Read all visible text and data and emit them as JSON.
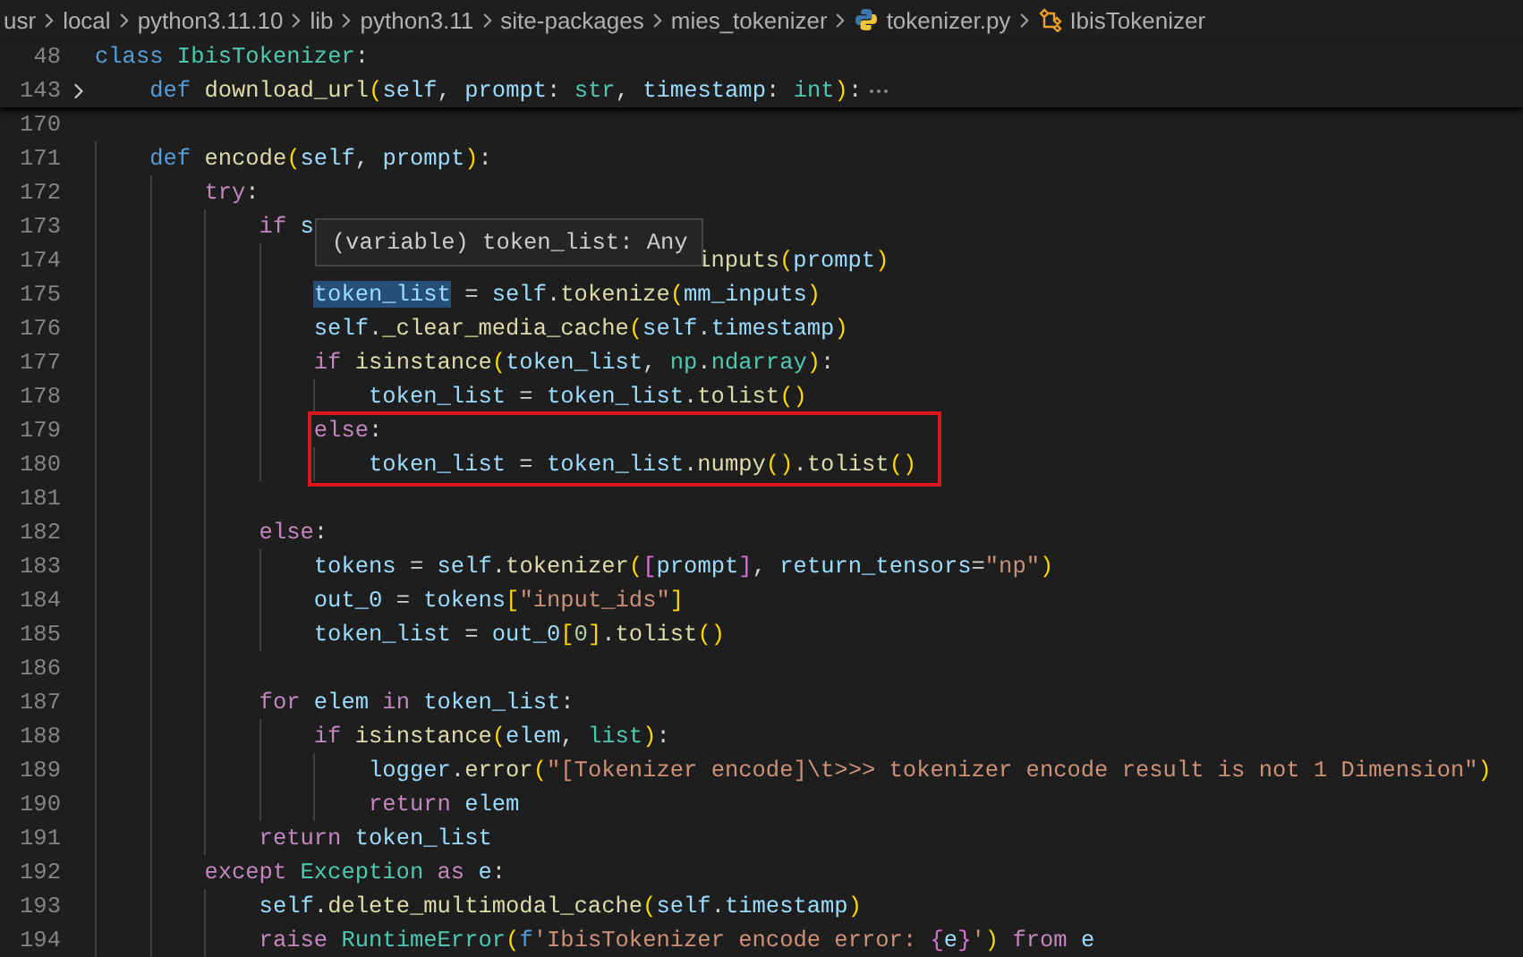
{
  "breadcrumbs": [
    {
      "label": "usr",
      "kind": "folder"
    },
    {
      "label": "local",
      "kind": "folder"
    },
    {
      "label": "python3.11.10",
      "kind": "folder"
    },
    {
      "label": "lib",
      "kind": "folder"
    },
    {
      "label": "python3.11",
      "kind": "folder"
    },
    {
      "label": "site-packages",
      "kind": "folder"
    },
    {
      "label": "mies_tokenizer",
      "kind": "folder"
    },
    {
      "label": "tokenizer.py",
      "kind": "file"
    },
    {
      "label": "IbisTokenizer",
      "kind": "class"
    }
  ],
  "sticky_lines": [
    {
      "number": "48",
      "folded": false,
      "tokens": [
        {
          "text": "class ",
          "kind": "storage"
        },
        {
          "text": "IbisTokenizer",
          "kind": "type"
        },
        {
          "text": ":",
          "kind": "punc"
        }
      ]
    },
    {
      "number": "143",
      "folded": true,
      "tokens": [
        {
          "text": "    def ",
          "kind": "storage"
        },
        {
          "text": "download_url",
          "kind": "fn"
        },
        {
          "text": "(",
          "kind": "b1"
        },
        {
          "text": "self",
          "kind": "var"
        },
        {
          "text": ", ",
          "kind": "punc"
        },
        {
          "text": "prompt",
          "kind": "var"
        },
        {
          "text": ": ",
          "kind": "punc"
        },
        {
          "text": "str",
          "kind": "type"
        },
        {
          "text": ", ",
          "kind": "punc"
        },
        {
          "text": "timestamp",
          "kind": "var"
        },
        {
          "text": ": ",
          "kind": "punc"
        },
        {
          "text": "int",
          "kind": "type"
        },
        {
          "text": ")",
          "kind": "b1"
        },
        {
          "text": ":",
          "kind": "punc"
        }
      ]
    }
  ],
  "lines": [
    {
      "number": "170",
      "boxed": false
    },
    {
      "number": "171",
      "boxed": false,
      "tokens": [
        {
          "text": "    def ",
          "kind": "storage"
        },
        {
          "text": "encode",
          "kind": "fn"
        },
        {
          "text": "(",
          "kind": "b1"
        },
        {
          "text": "self",
          "kind": "var"
        },
        {
          "text": ", ",
          "kind": "punc"
        },
        {
          "text": "prompt",
          "kind": "var"
        },
        {
          "text": ")",
          "kind": "b1"
        },
        {
          "text": ":",
          "kind": "punc"
        }
      ]
    },
    {
      "number": "172",
      "boxed": false,
      "tokens": [
        {
          "text": "        try",
          "kind": "control"
        },
        {
          "text": ":",
          "kind": "punc"
        }
      ]
    },
    {
      "number": "173",
      "boxed": false,
      "hover": "(variable) token_list: Any",
      "tokens": [
        {
          "text": "            if ",
          "kind": "control"
        },
        {
          "text": "s",
          "kind": "var"
        }
      ]
    },
    {
      "number": "174",
      "boxed": false,
      "tokens": [
        {
          "text": "                                            inputs",
          "kind": "fn"
        },
        {
          "text": "(",
          "kind": "b1"
        },
        {
          "text": "prompt",
          "kind": "var"
        },
        {
          "text": ")",
          "kind": "b1"
        }
      ]
    },
    {
      "number": "175",
      "boxed": false,
      "tokens": [
        {
          "text": "                token_list",
          "kind": "var",
          "highlighted": true
        },
        {
          "text": " = ",
          "kind": "punc"
        },
        {
          "text": "self",
          "kind": "var"
        },
        {
          "text": ".",
          "kind": "punc"
        },
        {
          "text": "tokenize",
          "kind": "fn"
        },
        {
          "text": "(",
          "kind": "b1"
        },
        {
          "text": "mm_inputs",
          "kind": "var"
        },
        {
          "text": ")",
          "kind": "b1"
        }
      ]
    },
    {
      "number": "176",
      "boxed": false,
      "tokens": [
        {
          "text": "                self",
          "kind": "var"
        },
        {
          "text": ".",
          "kind": "punc"
        },
        {
          "text": "_clear_media_cache",
          "kind": "fn"
        },
        {
          "text": "(",
          "kind": "b1"
        },
        {
          "text": "self",
          "kind": "var"
        },
        {
          "text": ".",
          "kind": "punc"
        },
        {
          "text": "timestamp",
          "kind": "var"
        },
        {
          "text": ")",
          "kind": "b1"
        }
      ]
    },
    {
      "number": "177",
      "boxed": false,
      "tokens": [
        {
          "text": "                if ",
          "kind": "control"
        },
        {
          "text": "isinstance",
          "kind": "fn"
        },
        {
          "text": "(",
          "kind": "b1"
        },
        {
          "text": "token_list",
          "kind": "var"
        },
        {
          "text": ", ",
          "kind": "punc"
        },
        {
          "text": "np",
          "kind": "type"
        },
        {
          "text": ".",
          "kind": "punc"
        },
        {
          "text": "ndarray",
          "kind": "type"
        },
        {
          "text": ")",
          "kind": "b1"
        },
        {
          "text": ":",
          "kind": "punc"
        }
      ]
    },
    {
      "number": "178",
      "boxed": false,
      "tokens": [
        {
          "text": "                    token_list",
          "kind": "var"
        },
        {
          "text": " = ",
          "kind": "punc"
        },
        {
          "text": "token_list",
          "kind": "var"
        },
        {
          "text": ".",
          "kind": "punc"
        },
        {
          "text": "tolist",
          "kind": "fn"
        },
        {
          "text": "()",
          "kind": "b1"
        }
      ]
    },
    {
      "number": "179",
      "boxed": true,
      "tokens": [
        {
          "text": "                else",
          "kind": "control"
        },
        {
          "text": ":",
          "kind": "punc"
        }
      ]
    },
    {
      "number": "180",
      "boxed": true,
      "tokens": [
        {
          "text": "                    token_list",
          "kind": "var"
        },
        {
          "text": " = ",
          "kind": "punc"
        },
        {
          "text": "token_list",
          "kind": "var"
        },
        {
          "text": ".",
          "kind": "punc"
        },
        {
          "text": "numpy",
          "kind": "fn"
        },
        {
          "text": "()",
          "kind": "b1"
        },
        {
          "text": ".",
          "kind": "punc"
        },
        {
          "text": "tolist",
          "kind": "fn"
        },
        {
          "text": "()",
          "kind": "b1"
        }
      ]
    },
    {
      "number": "181",
      "boxed": false
    },
    {
      "number": "182",
      "boxed": false,
      "tokens": [
        {
          "text": "            else",
          "kind": "control"
        },
        {
          "text": ":",
          "kind": "punc"
        }
      ]
    },
    {
      "number": "183",
      "boxed": false,
      "tokens": [
        {
          "text": "                tokens",
          "kind": "var"
        },
        {
          "text": " = ",
          "kind": "punc"
        },
        {
          "text": "self",
          "kind": "var"
        },
        {
          "text": ".",
          "kind": "punc"
        },
        {
          "text": "tokenizer",
          "kind": "fn"
        },
        {
          "text": "(",
          "kind": "b1"
        },
        {
          "text": "[",
          "kind": "b2"
        },
        {
          "text": "prompt",
          "kind": "var"
        },
        {
          "text": "]",
          "kind": "b2"
        },
        {
          "text": ", ",
          "kind": "punc"
        },
        {
          "text": "return_tensors",
          "kind": "var"
        },
        {
          "text": "=",
          "kind": "punc"
        },
        {
          "text": "\"np\"",
          "kind": "str"
        },
        {
          "text": ")",
          "kind": "b1"
        }
      ]
    },
    {
      "number": "184",
      "boxed": false,
      "tokens": [
        {
          "text": "                out_0",
          "kind": "var"
        },
        {
          "text": " = ",
          "kind": "punc"
        },
        {
          "text": "tokens",
          "kind": "var"
        },
        {
          "text": "[",
          "kind": "b1"
        },
        {
          "text": "\"input_ids\"",
          "kind": "str"
        },
        {
          "text": "]",
          "kind": "b1"
        }
      ]
    },
    {
      "number": "185",
      "boxed": false,
      "tokens": [
        {
          "text": "                token_list",
          "kind": "var"
        },
        {
          "text": " = ",
          "kind": "punc"
        },
        {
          "text": "out_0",
          "kind": "var"
        },
        {
          "text": "[",
          "kind": "b1"
        },
        {
          "text": "0",
          "kind": "num"
        },
        {
          "text": "]",
          "kind": "b1"
        },
        {
          "text": ".",
          "kind": "punc"
        },
        {
          "text": "tolist",
          "kind": "fn"
        },
        {
          "text": "()",
          "kind": "b1"
        }
      ]
    },
    {
      "number": "186",
      "boxed": false
    },
    {
      "number": "187",
      "boxed": false,
      "tokens": [
        {
          "text": "            for ",
          "kind": "control"
        },
        {
          "text": "elem",
          "kind": "var"
        },
        {
          "text": " in ",
          "kind": "control"
        },
        {
          "text": "token_list",
          "kind": "var"
        },
        {
          "text": ":",
          "kind": "punc"
        }
      ]
    },
    {
      "number": "188",
      "boxed": false,
      "tokens": [
        {
          "text": "                if ",
          "kind": "control"
        },
        {
          "text": "isinstance",
          "kind": "fn"
        },
        {
          "text": "(",
          "kind": "b1"
        },
        {
          "text": "elem",
          "kind": "var"
        },
        {
          "text": ", ",
          "kind": "punc"
        },
        {
          "text": "list",
          "kind": "type"
        },
        {
          "text": ")",
          "kind": "b1"
        },
        {
          "text": ":",
          "kind": "punc"
        }
      ]
    },
    {
      "number": "189",
      "boxed": false,
      "tokens": [
        {
          "text": "                    logger",
          "kind": "var"
        },
        {
          "text": ".",
          "kind": "punc"
        },
        {
          "text": "error",
          "kind": "fn"
        },
        {
          "text": "(",
          "kind": "b1"
        },
        {
          "text": "\"[Tokenizer encode]\\t>>> tokenizer encode result is not 1 Dimension\"",
          "kind": "str"
        },
        {
          "text": ")",
          "kind": "b1"
        }
      ]
    },
    {
      "number": "190",
      "boxed": false,
      "tokens": [
        {
          "text": "                    return ",
          "kind": "control"
        },
        {
          "text": "elem",
          "kind": "var"
        }
      ]
    },
    {
      "number": "191",
      "boxed": false,
      "tokens": [
        {
          "text": "            return ",
          "kind": "control"
        },
        {
          "text": "token_list",
          "kind": "var"
        }
      ]
    },
    {
      "number": "192",
      "boxed": false,
      "tokens": [
        {
          "text": "        except ",
          "kind": "control"
        },
        {
          "text": "Exception",
          "kind": "type"
        },
        {
          "text": " as ",
          "kind": "control"
        },
        {
          "text": "e",
          "kind": "var"
        },
        {
          "text": ":",
          "kind": "punc"
        }
      ]
    },
    {
      "number": "193",
      "boxed": false,
      "tokens": [
        {
          "text": "            self",
          "kind": "var"
        },
        {
          "text": ".",
          "kind": "punc"
        },
        {
          "text": "delete_multimodal_cache",
          "kind": "fn"
        },
        {
          "text": "(",
          "kind": "b1"
        },
        {
          "text": "self",
          "kind": "var"
        },
        {
          "text": ".",
          "kind": "punc"
        },
        {
          "text": "timestamp",
          "kind": "var"
        },
        {
          "text": ")",
          "kind": "b1"
        }
      ]
    },
    {
      "number": "194",
      "boxed": false,
      "tokens": [
        {
          "text": "            raise ",
          "kind": "control"
        },
        {
          "text": "RuntimeError",
          "kind": "type"
        },
        {
          "text": "(",
          "kind": "b1"
        },
        {
          "text": "f",
          "kind": "storage"
        },
        {
          "text": "'IbisTokenizer encode error: ",
          "kind": "str"
        },
        {
          "text": "{",
          "kind": "b2"
        },
        {
          "text": "e",
          "kind": "var"
        },
        {
          "text": "}",
          "kind": "b2"
        },
        {
          "text": "'",
          "kind": "str"
        },
        {
          "text": ")",
          "kind": "b1"
        },
        {
          "text": " from ",
          "kind": "control"
        },
        {
          "text": "e",
          "kind": "var"
        }
      ]
    }
  ]
}
